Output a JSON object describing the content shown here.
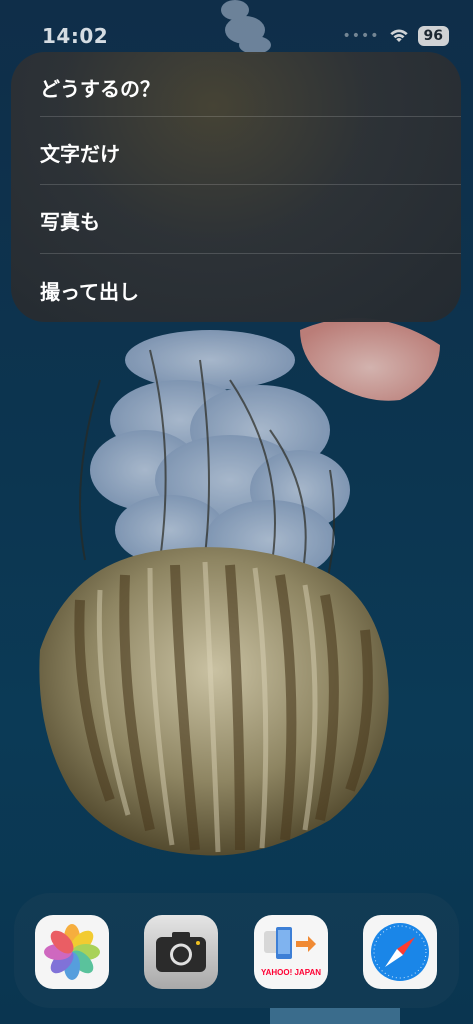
{
  "status": {
    "time": "14:02",
    "battery": "96",
    "signal_icon": "dots-icon",
    "wifi_icon": "wifi-icon"
  },
  "menu": {
    "title": "どうするの？",
    "items": [
      {
        "label": "文字だけ"
      },
      {
        "label": "写真も"
      },
      {
        "label": "撮って出し"
      }
    ]
  },
  "dock": {
    "apps": [
      {
        "name": "photos",
        "icon": "photos-icon"
      },
      {
        "name": "camera",
        "icon": "camera-icon"
      },
      {
        "name": "yahoo-japan",
        "icon": "yahoo-japan-icon",
        "brand_text": "YAHOO! JAPAN"
      },
      {
        "name": "safari",
        "icon": "safari-icon"
      }
    ]
  },
  "colors": {
    "background": "#0c3550",
    "menu_background": "#2e3236",
    "dock_background": "#163e56"
  }
}
